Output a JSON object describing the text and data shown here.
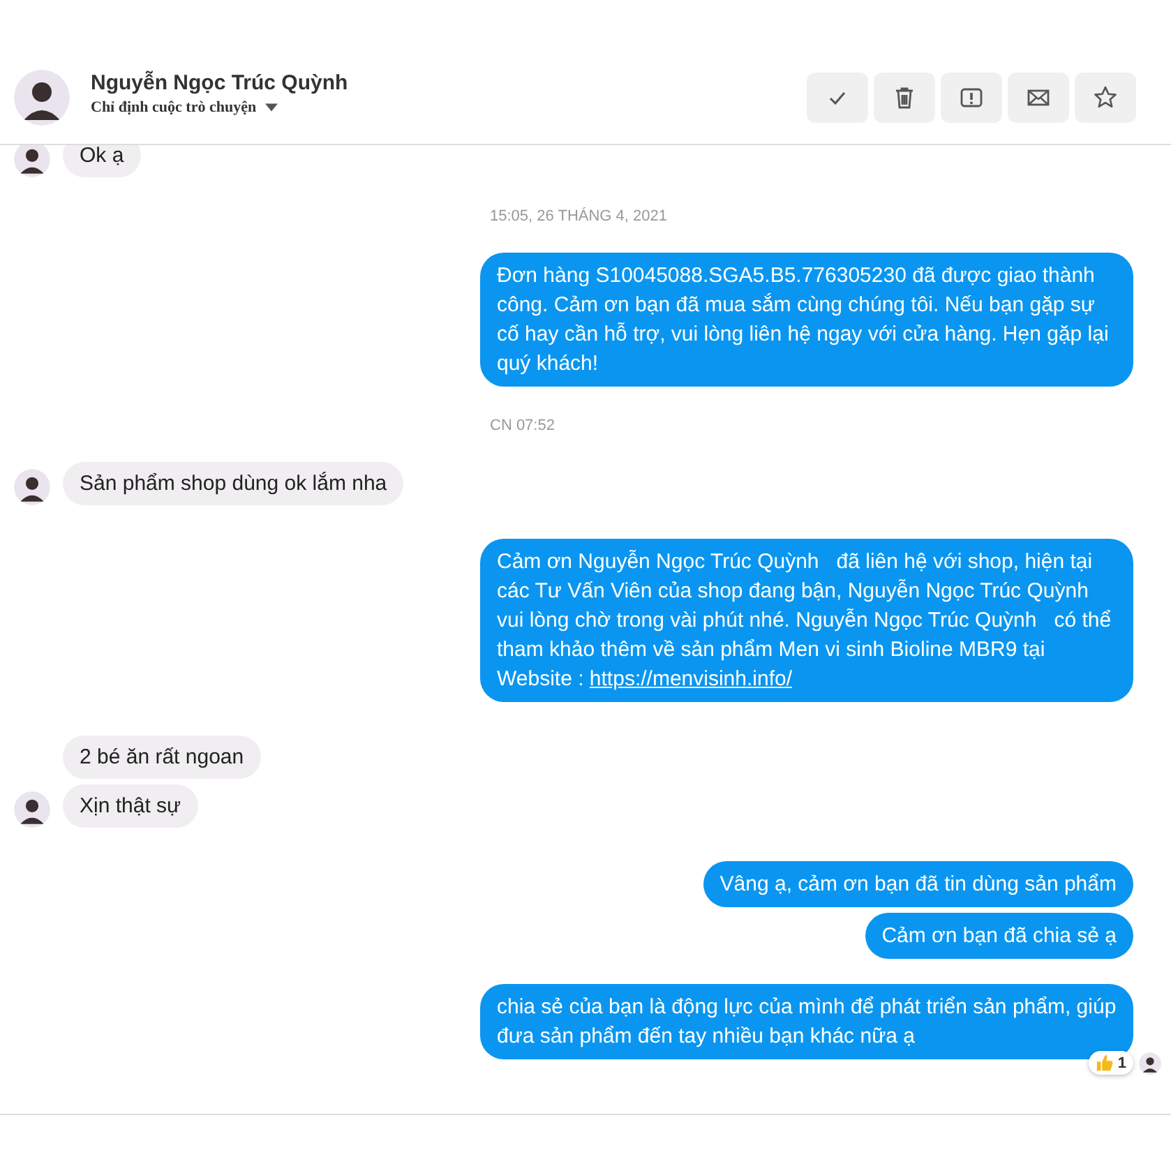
{
  "header": {
    "name": "Nguyễn Ngọc Trúc Quỳnh",
    "assign": "Chỉ định cuộc trò chuyện",
    "actions": [
      {
        "kind": "check"
      },
      {
        "kind": "trash"
      },
      {
        "kind": "alert"
      },
      {
        "kind": "mail"
      },
      {
        "kind": "star"
      }
    ]
  },
  "messages": [
    {
      "kind": "incoming",
      "text": "Ok ạ",
      "avatar": true
    },
    {
      "kind": "timestamp",
      "text": "15:05, 26 THÁNG 4, 2021"
    },
    {
      "kind": "outgoing",
      "text": "Đơn hàng S10045088.SGA5.B5.776305230 đã được giao thành công. Cảm ơn bạn đã mua sắm cùng chúng tôi. Nếu bạn gặp sự cố hay cần hỗ trợ, vui lòng liên hệ ngay với cửa hàng. Hẹn gặp lại quý khách!"
    },
    {
      "kind": "timestamp",
      "text": "CN 07:52"
    },
    {
      "kind": "incoming",
      "text": "Sản phẩm shop dùng ok lắm nha",
      "avatar": true
    },
    {
      "kind": "outgoing",
      "text": "Cảm ơn Nguyễn Ngọc Trúc Quỳnh   đã liên hệ với shop, hiện tại các Tư Vấn Viên của shop đang bận, Nguyễn Ngọc Trúc Quỳnh vui lòng chờ trong vài phút nhé. Nguyễn Ngọc Trúc Quỳnh   có thể tham khảo thêm về sản phẩm Men vi sinh Bioline MBR9 tại Website : ",
      "link": "https://menvisinh.info/"
    },
    {
      "kind": "incoming",
      "text": "2 bé ăn rất ngoan",
      "avatar": false
    },
    {
      "kind": "incoming",
      "text": "Xịn thật sự",
      "avatar": true
    },
    {
      "kind": "outgoing",
      "text": "Vâng ạ, cảm ơn bạn đã tin dùng sản phẩm"
    },
    {
      "kind": "outgoing",
      "text": "Cảm ơn bạn đã chia sẻ ạ"
    },
    {
      "kind": "outgoing",
      "text": "chia sẻ của bạn là động lực của mình để phát triển sản phẩm, giúp đưa sản phẩm đến tay nhiều bạn khác nữa ạ",
      "reaction": {
        "count": "1"
      }
    }
  ]
}
